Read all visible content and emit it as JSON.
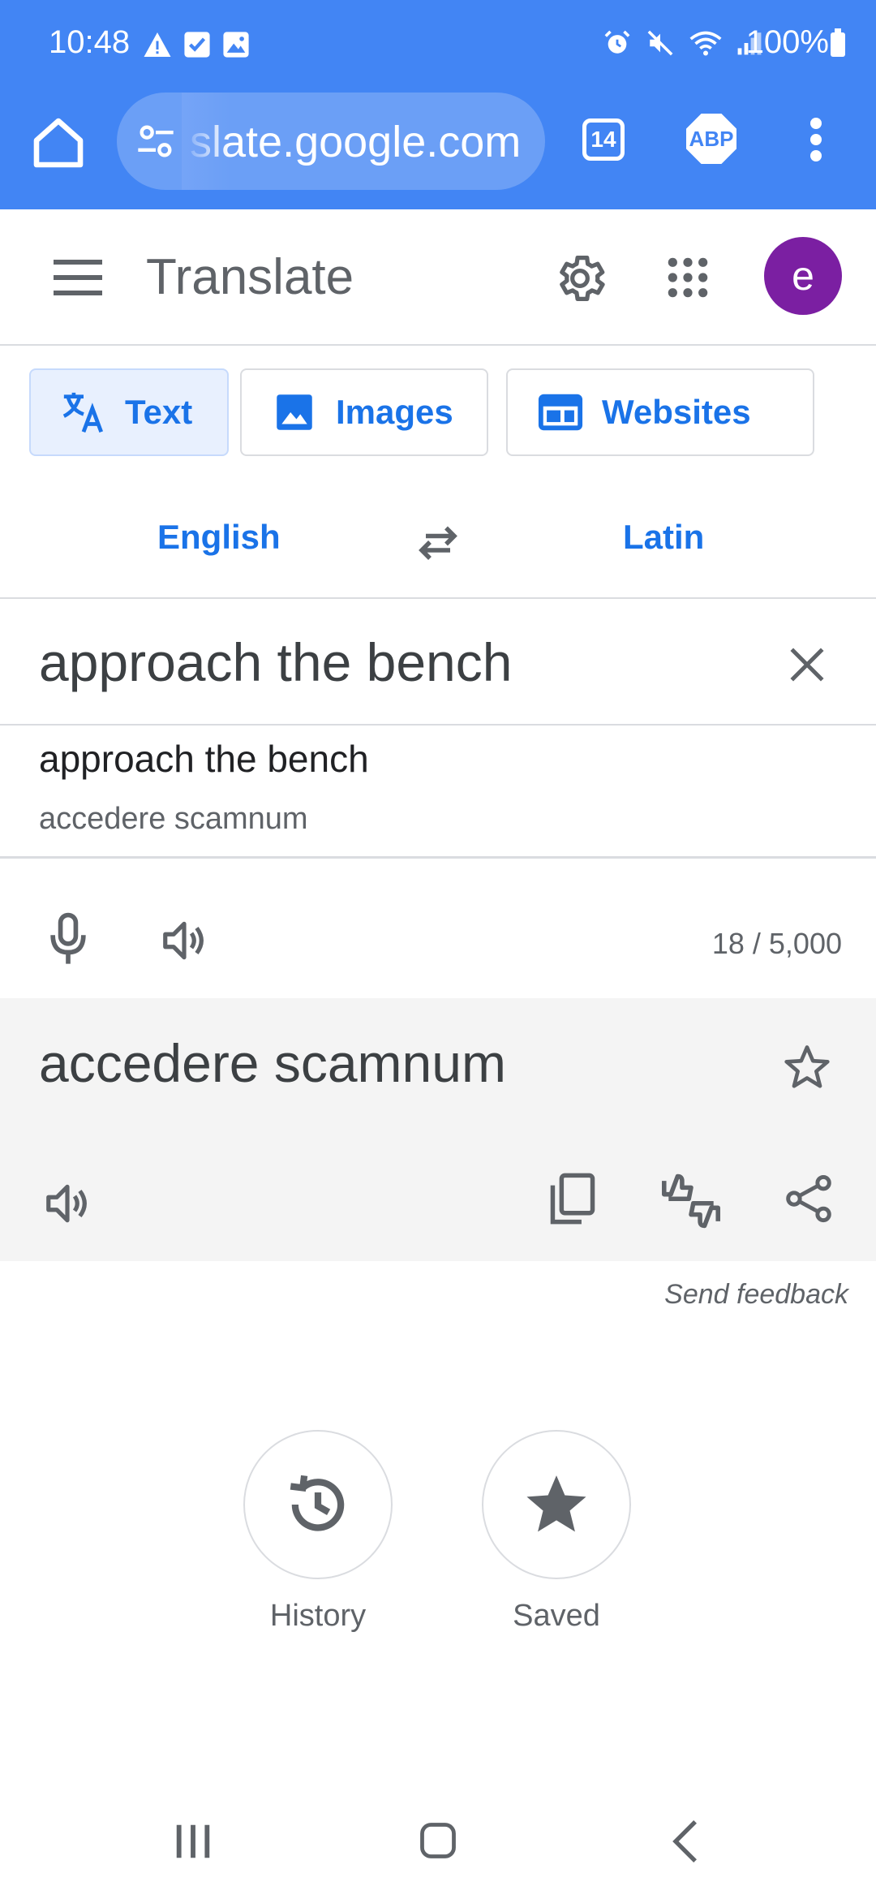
{
  "status_bar": {
    "time": "10:48",
    "battery": "100%",
    "left_icons": [
      "warning-icon",
      "check-icon",
      "image-icon"
    ],
    "right_icons": [
      "alarm-icon",
      "mute-icon",
      "wifi-icon",
      "signal-icon",
      "battery-icon"
    ]
  },
  "browser": {
    "url": "slate.google.com",
    "tab_count": "14",
    "extension_label": "ABP"
  },
  "app": {
    "title": "Translate",
    "avatar_initial": "e"
  },
  "modes": [
    {
      "label": "Text",
      "active": true
    },
    {
      "label": "Images",
      "active": false
    },
    {
      "label": "Websites",
      "active": false
    }
  ],
  "languages": {
    "source": "English",
    "target": "Latin"
  },
  "input": {
    "source_text": "approach the bench",
    "char_count": "18 / 5,000"
  },
  "suggestion": {
    "text": "approach the bench",
    "translation": "accedere scamnum"
  },
  "output": {
    "translation": "accedere scamnum",
    "feedback_label": "Send feedback"
  },
  "bottom": {
    "history_label": "History",
    "saved_label": "Saved"
  },
  "colors": {
    "chrome": "#4285f4",
    "accent": "#1a73e8",
    "avatar": "#7b1fa2",
    "output_bg": "#f4f4f4"
  }
}
